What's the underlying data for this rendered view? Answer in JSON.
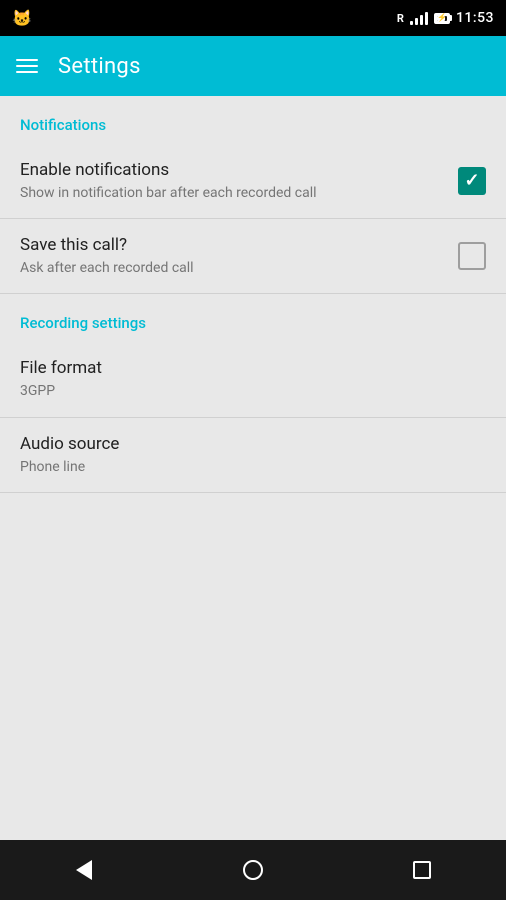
{
  "statusBar": {
    "time": "11:53",
    "icons": [
      "signal",
      "battery"
    ]
  },
  "appBar": {
    "title": "Settings",
    "menuIcon": "hamburger-icon"
  },
  "sections": [
    {
      "id": "notifications",
      "header": "Notifications",
      "items": [
        {
          "id": "enable-notifications",
          "title": "Enable notifications",
          "subtitle": "Show in notification bar after each recorded call",
          "control": "checkbox-checked"
        },
        {
          "id": "save-call",
          "title": "Save this call?",
          "subtitle": "Ask after each recorded call",
          "control": "checkbox-unchecked"
        }
      ]
    },
    {
      "id": "recording-settings",
      "header": "Recording settings",
      "items": [
        {
          "id": "file-format",
          "title": "File format",
          "subtitle": "3GPP",
          "control": "none"
        },
        {
          "id": "audio-source",
          "title": "Audio source",
          "subtitle": "Phone line",
          "control": "none"
        }
      ]
    }
  ],
  "navBar": {
    "backLabel": "back",
    "homeLabel": "home",
    "recentsLabel": "recents"
  },
  "colors": {
    "accent": "#00bcd4",
    "checkboxChecked": "#00897b"
  }
}
